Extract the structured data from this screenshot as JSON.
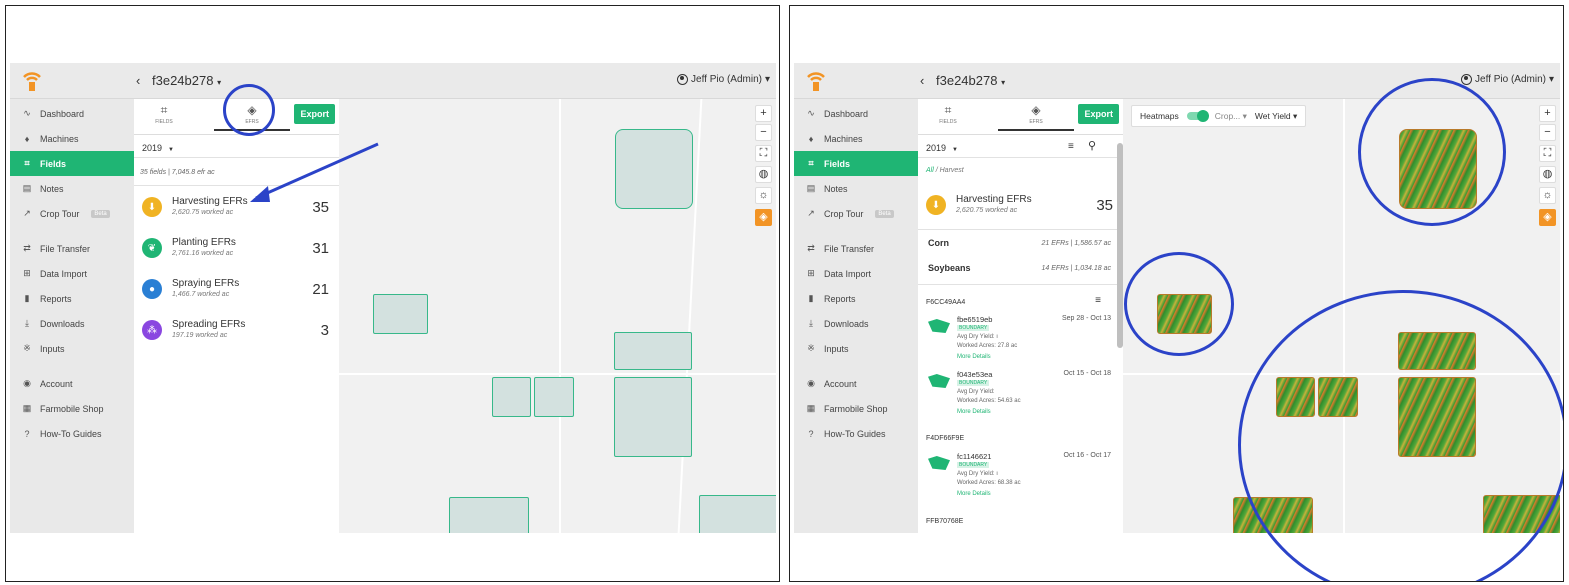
{
  "header": {
    "back": "‹",
    "field_id": "f3e24b278",
    "caret": "▾",
    "user": "Jeff Pio (Admin)"
  },
  "sidebar": {
    "items": [
      {
        "icon": "∿",
        "label": "Dashboard"
      },
      {
        "icon": "♦",
        "label": "Machines"
      },
      {
        "icon": "⌗",
        "label": "Fields",
        "active": true
      },
      {
        "icon": "▤",
        "label": "Notes"
      },
      {
        "icon": "↗",
        "label": "Crop Tour",
        "badge": "Beta"
      },
      {
        "icon": "⇄",
        "label": "File Transfer"
      },
      {
        "icon": "⊞",
        "label": "Data Import"
      },
      {
        "icon": "▮",
        "label": "Reports"
      },
      {
        "icon": "⤓",
        "label": "Downloads"
      },
      {
        "icon": "※",
        "label": "Inputs"
      },
      {
        "icon": "◉",
        "label": "Account"
      },
      {
        "icon": "▦",
        "label": "Farmobile Shop"
      },
      {
        "icon": "?",
        "label": "How-To Guides"
      }
    ]
  },
  "tabs": {
    "fields": "FIELDS",
    "efrs": "EFRS",
    "export": "Export"
  },
  "year": "2019",
  "left_panel": {
    "summary": "35 fields | 7,045.8 efr ac",
    "efrs": [
      {
        "name": "Harvesting EFRs",
        "sub": "2,620.75 worked ac",
        "count": "35",
        "color": "#f0b323",
        "icon": "harvest-icon"
      },
      {
        "name": "Planting EFRs",
        "sub": "2,761.16 worked ac",
        "count": "31",
        "color": "#1fb574",
        "icon": "leaf-icon"
      },
      {
        "name": "Spraying EFRs",
        "sub": "1,466.7 worked ac",
        "count": "21",
        "color": "#2a7fd4",
        "icon": "drop-icon"
      },
      {
        "name": "Spreading EFRs",
        "sub": "197.19 worked ac",
        "count": "3",
        "color": "#8a47e0",
        "icon": "spread-icon"
      }
    ]
  },
  "right_panel": {
    "breadcrumb_all": "All",
    "breadcrumb_cur": "/ Harvest",
    "harvest": {
      "name": "Harvesting EFRs",
      "sub": "2,620.75 worked ac",
      "count": "35"
    },
    "crops": [
      {
        "name": "Corn",
        "detail": "21 EFRs | 1,586.57 ac"
      },
      {
        "name": "Soybeans",
        "detail": "14 EFRs | 1,034.18 ac"
      }
    ],
    "groups": [
      "F6CC49AA4",
      "F4DF66F9E",
      "FFB70768E"
    ],
    "records": [
      {
        "id": "fbe6519eb",
        "badge": "BOUNDARY",
        "yield": "Avg Dry Yield: ı",
        "acres": "Worked Acres: 27.8 ac",
        "more": "More Details",
        "dates": "Sep 28 - Oct 13"
      },
      {
        "id": "f043e53ea",
        "badge": "BOUNDARY",
        "yield": "Avg Dry Yield:",
        "acres": "Worked Acres: 54.63 ac",
        "more": "More Details",
        "dates": "Oct 15 - Oct 18"
      },
      {
        "id": "fc1146621",
        "badge": "BOUNDARY",
        "yield": "Avg Dry Yield: ı",
        "acres": "Worked Acres: 68.38 ac",
        "more": "More Details",
        "dates": "Oct 16 - Oct 17"
      }
    ],
    "heatmap": {
      "label": "Heatmaps",
      "crop": "Crop...",
      "layer": "Wet Yield"
    }
  },
  "map_controls": [
    "+",
    "−",
    "⛶",
    "◍",
    "☼",
    "◈"
  ]
}
